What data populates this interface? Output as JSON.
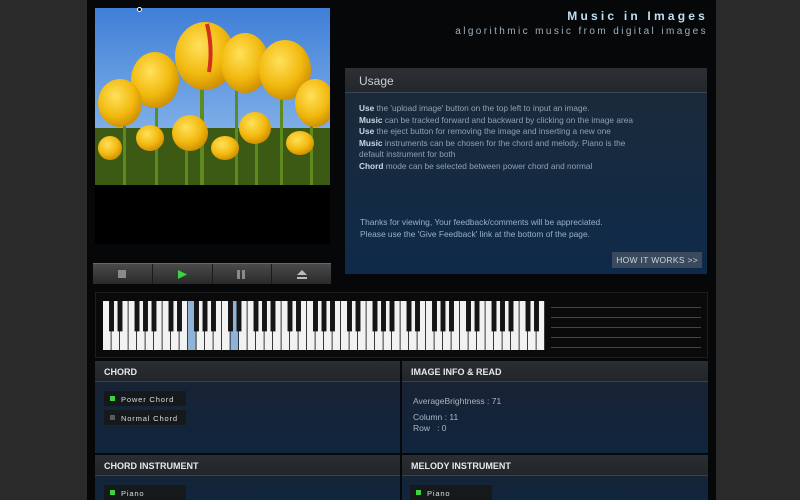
{
  "header": {
    "title": "Music in Images",
    "subtitle": "algorithmic music from digital images"
  },
  "image": {
    "alt": "yellow tulips"
  },
  "transport": [
    {
      "name": "stop",
      "icon": "stop-icon"
    },
    {
      "name": "play",
      "icon": "play-icon"
    },
    {
      "name": "pause",
      "icon": "pause-icon"
    },
    {
      "name": "eject",
      "icon": "eject-icon"
    }
  ],
  "usage": {
    "heading": "Usage",
    "lines": [
      {
        "bold": "Use",
        "text": " the 'upload image' button on the top left to input an image."
      },
      {
        "bold": "Music",
        "text": " can be tracked forward and backward by clicking on the image area"
      },
      {
        "bold": "Use",
        "text": " the eject button for removing the image and inserting a new one"
      },
      {
        "bold": "Music",
        "text": " instruments can be chosen for the chord and melody. Piano is the default instrument for both"
      },
      {
        "bold": "Chord",
        "text": " mode can be selected between power chord and normal"
      }
    ],
    "thanks_1": "Thanks for viewing, Your feedback/comments will be appreciated.",
    "thanks_2": "Please use the 'Give Feedback' link at the bottom of the page.",
    "how_label": "HOW IT WORKS >>"
  },
  "keyboard": {
    "white_keys": 52,
    "highlighted_white_keys": [
      10,
      15
    ],
    "highlight_color": "#8fb3d6",
    "black_pattern": [
      1,
      1,
      0,
      1,
      1,
      1,
      0
    ]
  },
  "chord": {
    "heading": "CHORD",
    "options": [
      {
        "label": "Power Chord",
        "selected": true
      },
      {
        "label": "Normal Chord",
        "selected": false
      }
    ]
  },
  "image_info": {
    "heading": "IMAGE INFO & READ",
    "brightness": "AverageBrightness : 71",
    "column": "Column : 11",
    "row": "Row   : 0"
  },
  "chord_instrument": {
    "heading": "CHORD INSTRUMENT",
    "selected": "Piano"
  },
  "melody_instrument": {
    "heading": "MELODY INSTRUMENT",
    "selected": "Piano"
  },
  "colors": {
    "accent_green": "#3fd23f",
    "panel_blue": "#10253e",
    "title_blue": "#bfe0f3"
  }
}
